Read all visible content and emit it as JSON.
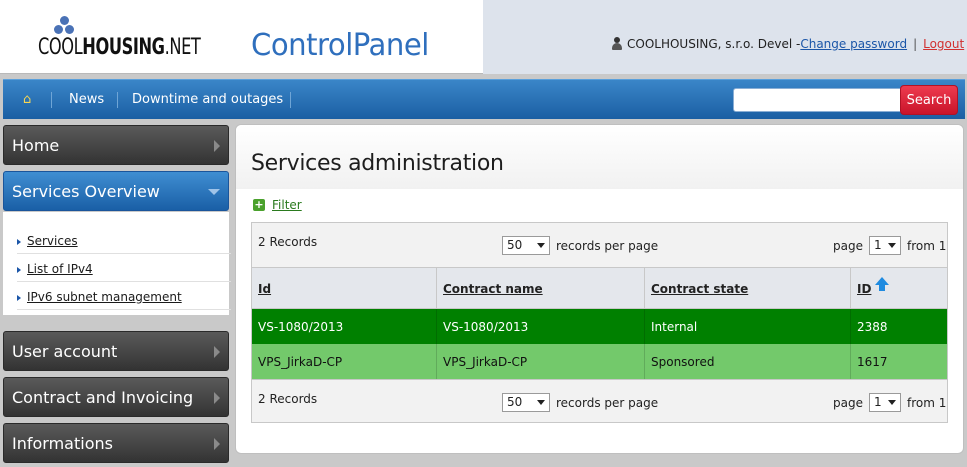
{
  "header": {
    "logo_prefix": "COOL",
    "logo_bold": "HOUSING",
    "logo_suffix": ".NET",
    "app_title": "ControlPanel",
    "user_text": "COOLHOUSING, s.r.o. Devel -",
    "change_password": "Change password",
    "separator": "|",
    "logout": "Logout"
  },
  "nav": {
    "home_icon": "home-icon",
    "items": [
      "News",
      "Downtime and outages"
    ],
    "search_placeholder": "",
    "search_label": "Search"
  },
  "sidebar": {
    "home": "Home",
    "services_overview": "Services Overview",
    "sub_items": [
      "Services",
      "List of IPv4",
      "IPv6 subnet management"
    ],
    "user_account": "User account",
    "contract_invoicing": "Contract and Invoicing",
    "informations": "Informations"
  },
  "main": {
    "title": "Services administration",
    "filter": "Filter",
    "records": "2 Records",
    "per_page_value": "50",
    "per_page_label": "records per page",
    "page_label": "page",
    "page_value": "1",
    "from_label": "from 1",
    "columns": [
      "Id",
      "Contract name",
      "Contract state",
      "ID"
    ],
    "rows": [
      [
        "VS-1080/2013",
        "VS-1080/2013",
        "Internal",
        "2388"
      ],
      [
        "VPS_JirkaD-CP",
        "VPS_JirkaD-CP",
        "Sponsored",
        "1617"
      ]
    ],
    "colors": {
      "row_internal": "#008000",
      "row_sponsored": "#73c96b"
    }
  }
}
